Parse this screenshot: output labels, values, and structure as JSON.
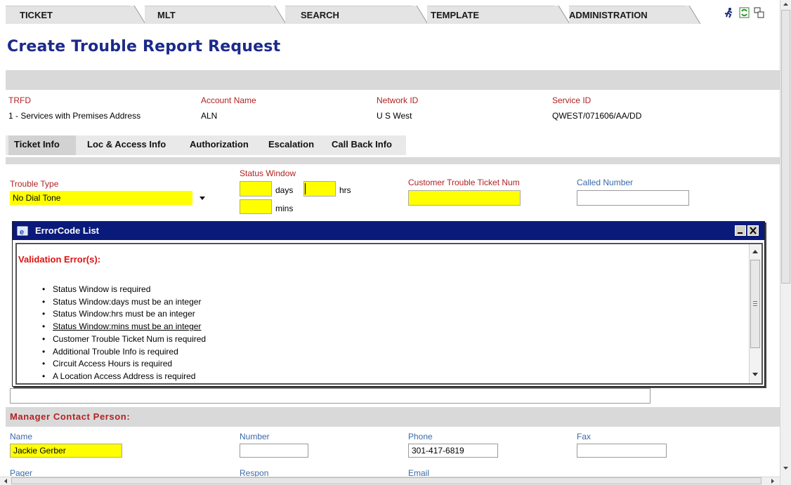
{
  "nav": {
    "tabs": [
      {
        "label": "TICKET"
      },
      {
        "label": "MLT"
      },
      {
        "label": "SEARCH"
      },
      {
        "label": "TEMPLATE"
      },
      {
        "label": "ADMINISTRATION"
      }
    ],
    "icons": [
      "run-icon",
      "refresh-icon",
      "window-icon"
    ]
  },
  "page": {
    "title": "Create Trouble Report Request"
  },
  "summary": {
    "trfd_label": "TRFD",
    "trfd_value": "1 - Services with Premises Address",
    "account_label": "Account Name",
    "account_value": "ALN",
    "network_label": "Network ID",
    "network_value": "U S West",
    "service_label": "Service ID",
    "service_value": "QWEST/071606/AA/DD"
  },
  "subtabs": [
    "Ticket Info",
    "Loc & Access Info",
    "Authorization",
    "Escalation",
    "Call Back Info"
  ],
  "form": {
    "trouble_type_label": "Trouble Type",
    "trouble_type_value": "No Dial Tone",
    "status_window_label": "Status Window",
    "days_label": "days",
    "hrs_label": "hrs",
    "mins_label": "mins",
    "customer_ticket_label": "Customer Trouble Ticket Num",
    "called_number_label": "Called Number"
  },
  "dialog": {
    "title": "ErrorCode List",
    "heading": "Validation Error(s):",
    "errors": [
      "Status Window is required",
      "Status Window:days must be an integer",
      "Status Window:hrs must be an integer",
      "Status Window:mins must be an integer",
      "Customer Trouble Ticket Num is required",
      "Additional Trouble Info is required",
      "Circuit Access Hours is required",
      "A Location Access Address is required"
    ]
  },
  "manager": {
    "heading": "Manager Contact Person:",
    "name_label": "Name",
    "name_value": "Jackie Gerber",
    "number_label": "Number",
    "phone_label": "Phone",
    "phone_value": "301-417-6819",
    "fax_label": "Fax",
    "pager_label": "Pager",
    "respon_label": "Respon",
    "email_label": "Email"
  },
  "colors": {
    "title_blue": "#1c2a8a",
    "label_red": "#b22222",
    "label_blue": "#3a6aa8",
    "required_yellow": "#ffff00",
    "dialog_titlebar": "#0a1a7a",
    "error_red": "#e01010"
  }
}
